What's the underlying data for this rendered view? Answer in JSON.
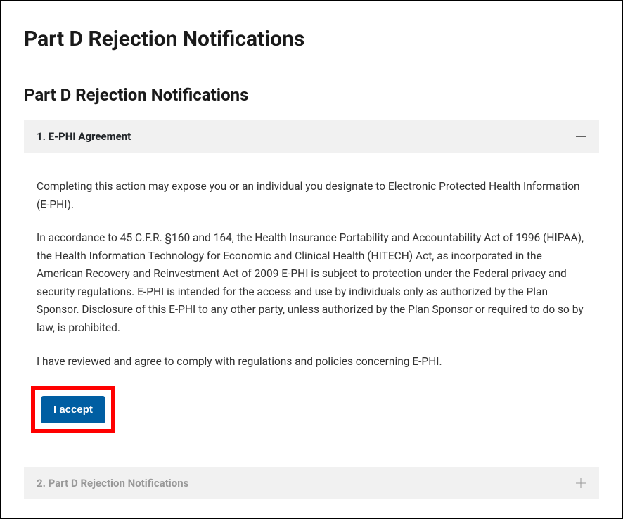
{
  "page_title": "Part D Rejection Notifications",
  "section_title": "Part D Rejection Notifications",
  "accordion": {
    "items": [
      {
        "title": "1. E-PHI Agreement",
        "expanded": true,
        "paragraphs": [
          "Completing this action may expose you or an individual you designate to Electronic Protected Health Information (E-PHI).",
          "In accordance to 45 C.F.R. §160 and 164, the Health Insurance Portability and Accountability Act of 1996 (HIPAA), the Health Information Technology for Economic and Clinical Health (HITECH) Act, as incorporated in the American Recovery and Reinvestment Act of 2009 E-PHI is subject to protection under the Federal privacy and security regulations. E-PHI is intended for the access and use by individuals only as authorized by the Plan Sponsor. Disclosure of this E-PHI to any other party, unless authorized by the Plan Sponsor or required to do so by law, is prohibited.",
          "I have reviewed and agree to comply with regulations and policies concerning E-PHI."
        ],
        "button_label": "I accept"
      },
      {
        "title": "2. Part D Rejection Notifications",
        "expanded": false
      }
    ]
  }
}
